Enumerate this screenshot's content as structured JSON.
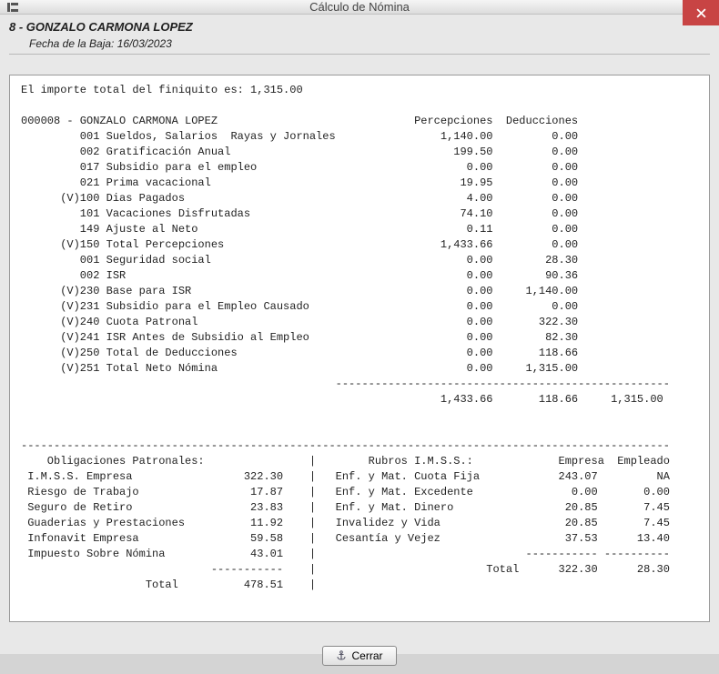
{
  "window": {
    "title": "Cálculo de Nómina"
  },
  "header": {
    "employee": "8 - GONZALO CARMONA LOPEZ",
    "baja_label": "Fecha de la Baja: 16/03/2023"
  },
  "report": {
    "finiquito_line": "El importe total del finiquito es: 1,315.00",
    "employee_line": "000008 - GONZALO CARMONA LOPEZ",
    "col_percepciones": "Percepciones",
    "col_deducciones": "Deducciones",
    "lines": [
      {
        "flag": "   ",
        "code": "001",
        "desc": "Sueldos, Salarios  Rayas y Jornales",
        "per": "1,140.00",
        "ded": "0.00"
      },
      {
        "flag": "   ",
        "code": "002",
        "desc": "Gratificación Anual",
        "per": "199.50",
        "ded": "0.00"
      },
      {
        "flag": "   ",
        "code": "017",
        "desc": "Subsidio para el empleo",
        "per": "0.00",
        "ded": "0.00"
      },
      {
        "flag": "   ",
        "code": "021",
        "desc": "Prima vacacional",
        "per": "19.95",
        "ded": "0.00"
      },
      {
        "flag": "(V)",
        "code": "100",
        "desc": "Dias Pagados",
        "per": "4.00",
        "ded": "0.00"
      },
      {
        "flag": "   ",
        "code": "101",
        "desc": "Vacaciones Disfrutadas",
        "per": "74.10",
        "ded": "0.00"
      },
      {
        "flag": "   ",
        "code": "149",
        "desc": "Ajuste al Neto",
        "per": "0.11",
        "ded": "0.00"
      },
      {
        "flag": "(V)",
        "code": "150",
        "desc": "Total Percepciones",
        "per": "1,433.66",
        "ded": "0.00"
      },
      {
        "flag": "   ",
        "code": "001",
        "desc": "Seguridad social",
        "per": "0.00",
        "ded": "28.30"
      },
      {
        "flag": "   ",
        "code": "002",
        "desc": "ISR",
        "per": "0.00",
        "ded": "90.36"
      },
      {
        "flag": "(V)",
        "code": "230",
        "desc": "Base para ISR",
        "per": "0.00",
        "ded": "1,140.00"
      },
      {
        "flag": "(V)",
        "code": "231",
        "desc": "Subsidio para el Empleo Causado",
        "per": "0.00",
        "ded": "0.00"
      },
      {
        "flag": "(V)",
        "code": "240",
        "desc": "Cuota Patronal",
        "per": "0.00",
        "ded": "322.30"
      },
      {
        "flag": "(V)",
        "code": "241",
        "desc": "ISR Antes de Subsidio al Empleo",
        "per": "0.00",
        "ded": "82.30"
      },
      {
        "flag": "(V)",
        "code": "250",
        "desc": "Total de Deducciones",
        "per": "0.00",
        "ded": "118.66"
      },
      {
        "flag": "(V)",
        "code": "251",
        "desc": "Total Neto Nómina",
        "per": "0.00",
        "ded": "1,315.00"
      }
    ],
    "totals": {
      "per": "1,433.66",
      "ded": "118.66",
      "net": "1,315.00"
    },
    "obligaciones": {
      "title": "Obligaciones Patronales:",
      "rows": [
        {
          "label": "I.M.S.S. Empresa",
          "val": "322.30"
        },
        {
          "label": "Riesgo de Trabajo",
          "val": "17.87"
        },
        {
          "label": "Seguro de Retiro",
          "val": "23.83"
        },
        {
          "label": "Guaderias y Prestaciones",
          "val": "11.92"
        },
        {
          "label": "Infonavit Empresa",
          "val": "59.58"
        },
        {
          "label": "Impuesto Sobre Nómina",
          "val": "43.01"
        }
      ],
      "total_label": "Total",
      "total_val": "478.51"
    },
    "rubros": {
      "title": "Rubros I.M.S.S.:",
      "col_empresa": "Empresa",
      "col_empleado": "Empleado",
      "rows": [
        {
          "label": "Enf. y Mat. Cuota Fija",
          "emp": "243.07",
          "empl": "NA"
        },
        {
          "label": "Enf. y Mat. Excedente",
          "emp": "0.00",
          "empl": "0.00"
        },
        {
          "label": "Enf. y Mat. Dinero",
          "emp": "20.85",
          "empl": "7.45"
        },
        {
          "label": "Invalidez y Vida",
          "emp": "20.85",
          "empl": "7.45"
        },
        {
          "label": "Cesantía y Vejez",
          "emp": "37.53",
          "empl": "13.40"
        }
      ],
      "total_label": "Total",
      "total_emp": "322.30",
      "total_empl": "28.30"
    }
  },
  "footer": {
    "close_label": "Cerrar"
  }
}
